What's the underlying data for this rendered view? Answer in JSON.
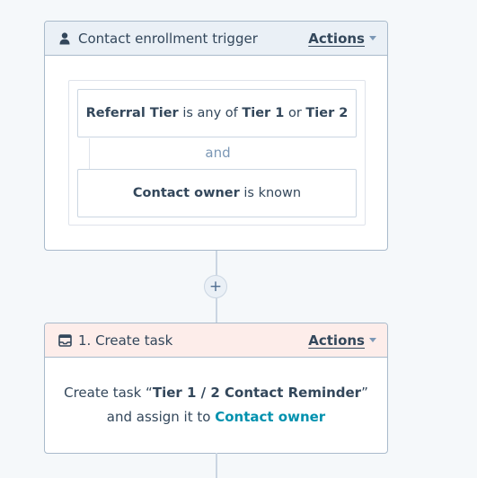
{
  "trigger": {
    "title": "Contact enrollment trigger",
    "actions_label": "Actions",
    "filter1": {
      "property": "Referral Tier",
      "operator": "is any of",
      "value1": "Tier 1",
      "joiner": "or",
      "value2": "Tier 2"
    },
    "and_label": "and",
    "filter2": {
      "property": "Contact owner",
      "operator": "is known"
    }
  },
  "add_step": {
    "label": "+"
  },
  "task": {
    "title": "1. Create task",
    "actions_label": "Actions",
    "line1_prefix": "Create task “",
    "task_name": "Tier 1 / 2 Contact Reminder",
    "line1_suffix": "”",
    "line2_prefix": "and assign it to",
    "assignee": "Contact owner"
  },
  "colors": {
    "trigger_header_bg": "#eaf0f6",
    "task_header_bg": "#fdedea",
    "link": "#0091ae",
    "text": "#33475b",
    "border": "#a9bacb"
  },
  "icons": {
    "trigger": "person-icon",
    "task": "task-icon",
    "caret": "caret-down-icon"
  }
}
